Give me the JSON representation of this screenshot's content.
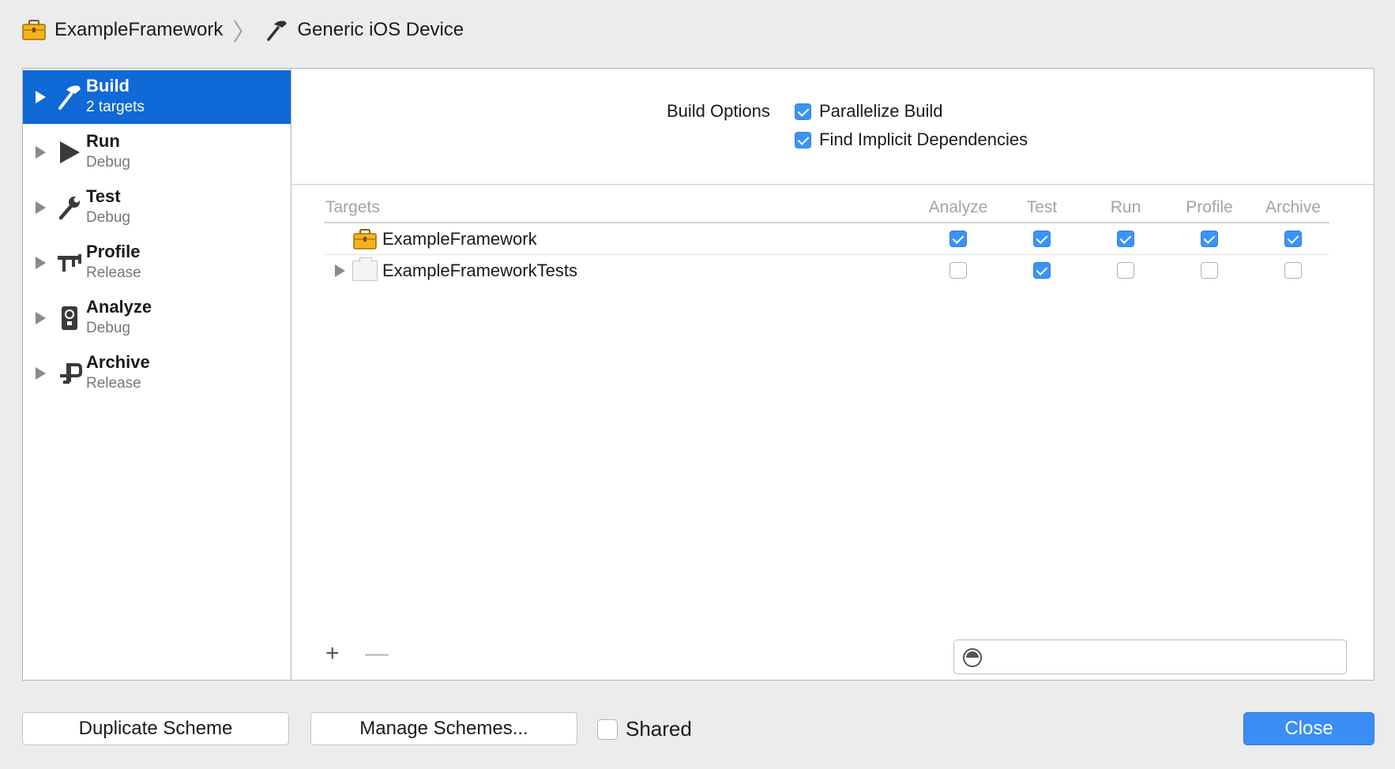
{
  "breadcrumb": {
    "scheme": "ExampleFramework",
    "destination": "Generic iOS Device"
  },
  "sidebar": {
    "items": [
      {
        "name": "Build",
        "sub": "2 targets",
        "icon": "hammer-icon",
        "selected": true
      },
      {
        "name": "Run",
        "sub": "Debug",
        "icon": "play-icon",
        "selected": false
      },
      {
        "name": "Test",
        "sub": "Debug",
        "icon": "wrench-icon",
        "selected": false
      },
      {
        "name": "Profile",
        "sub": "Release",
        "icon": "caliper-icon",
        "selected": false
      },
      {
        "name": "Analyze",
        "sub": "Debug",
        "icon": "analyze-icon",
        "selected": false
      },
      {
        "name": "Archive",
        "sub": "Release",
        "icon": "archive-icon",
        "selected": false
      }
    ]
  },
  "build_options": {
    "label": "Build Options",
    "parallelize": {
      "label": "Parallelize Build",
      "checked": true
    },
    "implicit": {
      "label": "Find Implicit Dependencies",
      "checked": true
    }
  },
  "targets_table": {
    "headers": [
      "Targets",
      "Analyze",
      "Test",
      "Run",
      "Profile",
      "Archive"
    ],
    "rows": [
      {
        "name": "ExampleFramework",
        "icon": "toolbox-icon",
        "expandable": false,
        "checks": [
          true,
          true,
          true,
          true,
          true
        ]
      },
      {
        "name": "ExampleFrameworkTests",
        "icon": "bundle-icon",
        "expandable": true,
        "checks": [
          false,
          true,
          false,
          false,
          false
        ]
      }
    ]
  },
  "footer": {
    "add": "+",
    "remove": "—",
    "filter_value": ""
  },
  "buttons": {
    "duplicate": "Duplicate Scheme",
    "manage": "Manage Schemes...",
    "shared": "Shared",
    "shared_checked": false,
    "close": "Close"
  },
  "colors": {
    "selection": "#0f69d6",
    "checkbox": "#3d93f5",
    "close_button": "#3a8ef5"
  }
}
